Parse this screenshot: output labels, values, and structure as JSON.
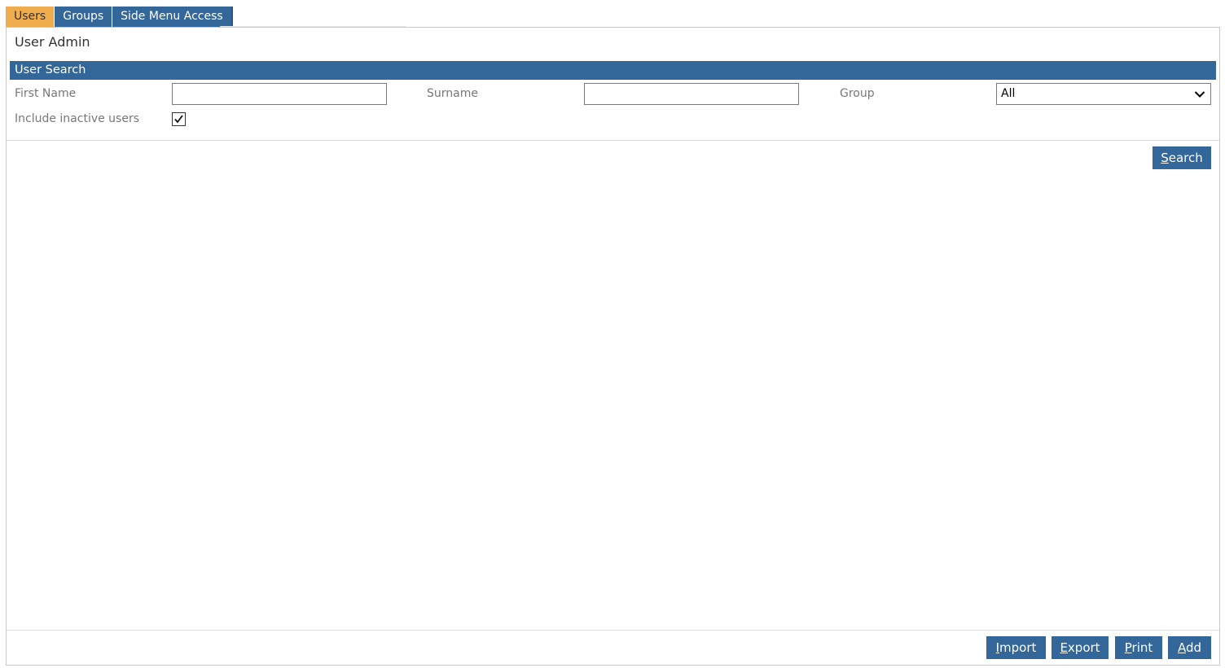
{
  "tabs": [
    {
      "label": "Users",
      "active": true
    },
    {
      "label": "Groups",
      "active": false
    },
    {
      "label": "Side Menu Access",
      "active": false
    }
  ],
  "page": {
    "title": "User Admin"
  },
  "search": {
    "section_title": "User Search",
    "first_name_label": "First Name",
    "first_name_value": "",
    "surname_label": "Surname",
    "surname_value": "",
    "group_label": "Group",
    "group_selected": "All",
    "inactive_label": "Include inactive users",
    "inactive_checked": true,
    "search_button": {
      "mnemonic": "S",
      "rest": "earch"
    }
  },
  "footer": {
    "import_button": {
      "mnemonic": "I",
      "rest": "mport"
    },
    "export_button": {
      "mnemonic": "E",
      "rest": "xport"
    },
    "print_button": {
      "mnemonic": "P",
      "rest": "rint"
    },
    "add_button": {
      "mnemonic": "A",
      "rest": "dd"
    }
  },
  "colors": {
    "primary": "#336699",
    "active_tab": "#f0ad4e",
    "label_text": "#777777"
  },
  "icons": {
    "dropdown": "chevron-down-icon",
    "checkbox": "checkmark-icon"
  }
}
